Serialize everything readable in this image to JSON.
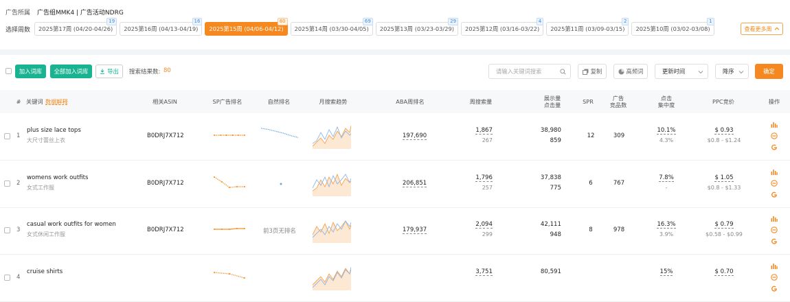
{
  "breadcrumb": {
    "label": "广告所属",
    "value": "广告组MMK4 | 广告活动NDRG"
  },
  "weeks": {
    "label": "选择周数",
    "items": [
      {
        "text": "2025第17周 (04/20-04/26)",
        "count": "19",
        "active": false
      },
      {
        "text": "2025第16周 (04/13-04/19)",
        "count": "16",
        "active": false
      },
      {
        "text": "2025第15周 (04/06-04/12)",
        "count": "80",
        "active": true
      },
      {
        "text": "2025第14周 (03/30-04/05)",
        "count": "69",
        "active": false
      },
      {
        "text": "2025第13周 (03/23-03/29)",
        "count": "29",
        "active": false
      },
      {
        "text": "2025第12周 (03/16-03/22)",
        "count": "4",
        "active": false
      },
      {
        "text": "2025第11周 (03/09-03/15)",
        "count": "2",
        "active": false
      },
      {
        "text": "2025第10周 (03/02-03/08)",
        "count": "1",
        "active": false
      }
    ],
    "more": "查看更多周"
  },
  "toolbar": {
    "add_to_lib": "加入词库",
    "add_all": "全部加入词库",
    "export": "导出",
    "result_label": "搜索结果数:",
    "result_count": "80",
    "search_placeholder": "请输入关键词搜索",
    "copy": "复制",
    "high_freq": "高频词",
    "sort_field": "更新时间",
    "sort_order": "降序",
    "confirm": "确定"
  },
  "table": {
    "headers": {
      "index": "#",
      "keyword": "关键词",
      "keyword_extra": "数据解释",
      "asin": "相关ASIN",
      "sp_rank": "SP广告排名",
      "natural_rank": "自然排名",
      "trend": "月搜索趋势",
      "aba": "ABA周排名",
      "weekly_search": "周搜索量",
      "impr_line1": "展示量",
      "impr_line2": "点击量",
      "spr": "SPR",
      "ad_line1": "广告",
      "ad_line2": "竞品数",
      "ctr_line1": "点击",
      "ctr_line2": "集中度",
      "ppc": "PPC竞价",
      "action": "操作"
    },
    "rows": [
      {
        "index": "1",
        "keyword": "plus size lace tops",
        "keyword_cn": "大尺寸蕾丝上衣",
        "asin": "B0DRJ7X712",
        "natural_text": "",
        "aba": "197,690",
        "ws1": "1,867",
        "ws2": "267",
        "imp": "38,980",
        "clk": "859",
        "spr": "12",
        "ads": "309",
        "ctr1": "10.1%",
        "ctr2": "4.3%",
        "ppc": "$ 0.93",
        "ppc_range": "$0.8 - $1.24",
        "sp_trend": [
          0.5,
          0.5,
          0.5,
          0.5,
          0.5,
          0.5
        ],
        "nat_trend": [
          0.1,
          0.2,
          0.35,
          0.5,
          0.7,
          0.85
        ]
      },
      {
        "index": "2",
        "keyword": "womens work outfits",
        "keyword_cn": "女式工作服",
        "asin": "B0DRJ7X712",
        "natural_text": "",
        "aba": "206,851",
        "ws1": "1,796",
        "ws2": "257",
        "imp": "37,838",
        "clk": "775",
        "spr": "6",
        "ads": "767",
        "ctr1": "7.8%",
        "ctr2": "-",
        "ppc": "$ 1.05",
        "ppc_range": "$0.8 - $1.33",
        "sp_trend": [
          0.1,
          0.45,
          0.85,
          0.8,
          0.8
        ],
        "nat_trend": []
      },
      {
        "index": "3",
        "keyword": "casual work outfits for women",
        "keyword_cn": "女式休闲工作服",
        "asin": "B0DRJ7X712",
        "natural_text": "前3页无排名",
        "aba": "179,937",
        "ws1": "2,094",
        "ws2": "299",
        "imp": "42,111",
        "clk": "948",
        "spr": "8",
        "ads": "978",
        "ctr1": "16.3%",
        "ctr2": "3.9%",
        "ppc": "$ 0.79",
        "ppc_range": "$0.58 - $0.99",
        "sp_trend": [
          0.5,
          0.5,
          0.5,
          0.45,
          0.45
        ],
        "nat_trend": []
      },
      {
        "index": "4",
        "keyword": "cruise shirts",
        "keyword_cn": "",
        "asin": "",
        "natural_text": "",
        "aba": "",
        "ws1": "3,751",
        "ws2": "",
        "imp": "80,591",
        "clk": "",
        "spr": "",
        "ads": "",
        "ctr1": "15%",
        "ctr2": "",
        "ppc": "$ 0.70",
        "ppc_range": "",
        "sp_trend": [
          0.2,
          0.3,
          0.6
        ],
        "nat_trend": []
      }
    ]
  },
  "colors": {
    "accent": "#f5891f",
    "green": "#19b391",
    "link": "#4a8ad6"
  },
  "icons": [
    "search-icon",
    "copy-icon",
    "pie-icon",
    "chevron-down-icon",
    "chevron-up-icon",
    "download-icon",
    "bar-chart-icon",
    "ban-icon",
    "google-icon"
  ]
}
